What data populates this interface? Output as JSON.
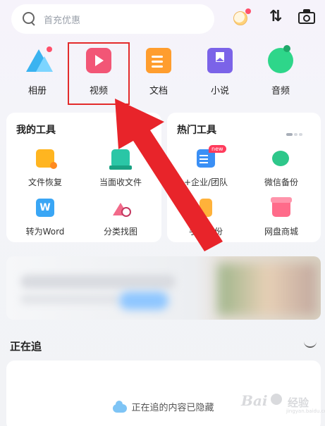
{
  "search": {
    "placeholder": "首充优惠"
  },
  "header_icons": {
    "transfer_glyph": "⇅"
  },
  "categories": [
    {
      "label": "相册",
      "icon": "photo-icon"
    },
    {
      "label": "视频",
      "icon": "video-icon"
    },
    {
      "label": "文档",
      "icon": "document-icon"
    },
    {
      "label": "小说",
      "icon": "novel-icon"
    },
    {
      "label": "音频",
      "icon": "audio-icon"
    }
  ],
  "my_tools": {
    "title": "我的工具",
    "items": [
      {
        "label": "文件恢复",
        "icon": "file-recovery-icon"
      },
      {
        "label": "当面收文件",
        "icon": "face-to-face-receive-icon"
      },
      {
        "label": "转为Word",
        "icon": "word-convert-icon"
      },
      {
        "label": "分类找图",
        "icon": "category-find-image-icon"
      }
    ]
  },
  "hot_tools": {
    "title": "热门工具",
    "new_badge": "new",
    "items": [
      {
        "label": "+企业/团队",
        "icon": "team-icon"
      },
      {
        "label": "微信备份",
        "icon": "wechat-backup-icon"
      },
      {
        "label": "手机备份",
        "icon": "phone-backup-icon"
      },
      {
        "label": "网盘商城",
        "icon": "store-icon"
      }
    ]
  },
  "following": {
    "title": "正在追",
    "empty_message": "正在追的内容已隐藏"
  },
  "watermark": {
    "brand": "Bai",
    "sub": "经验",
    "url": "jingyan.baidu.com"
  },
  "colors": {
    "highlight": "#e32b2b",
    "video": "#f25676",
    "document": "#ff9d2e",
    "novel": "#7b63e8",
    "audio": "#2ed68a",
    "photo": "#3ab3f0"
  }
}
